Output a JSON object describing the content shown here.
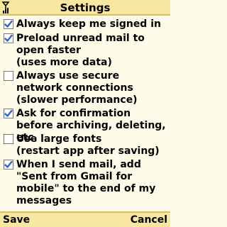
{
  "header": {
    "title": "Settings",
    "signal_icon": "signal-strength-icon"
  },
  "options": [
    {
      "label": "Always keep me signed in",
      "checked": true
    },
    {
      "label": "Preload unread mail to open faster\n(uses more data)",
      "checked": true
    },
    {
      "label": "Always use secure network connections\n(slower performance)",
      "checked": false
    },
    {
      "label": "Ask for confirmation before archiving, deleting, etc.",
      "checked": true
    },
    {
      "label": "Use large fonts\n(restart app after saving)",
      "checked": false
    },
    {
      "label": "When I send mail, add \"Sent from Gmail for mobile\" to the end of my messages",
      "checked": true
    }
  ],
  "softkeys": {
    "left": "Save",
    "right": "Cancel"
  },
  "colors": {
    "bar": "#f7e7a0",
    "background": "#fefbe8",
    "check": "#2f66c8"
  }
}
